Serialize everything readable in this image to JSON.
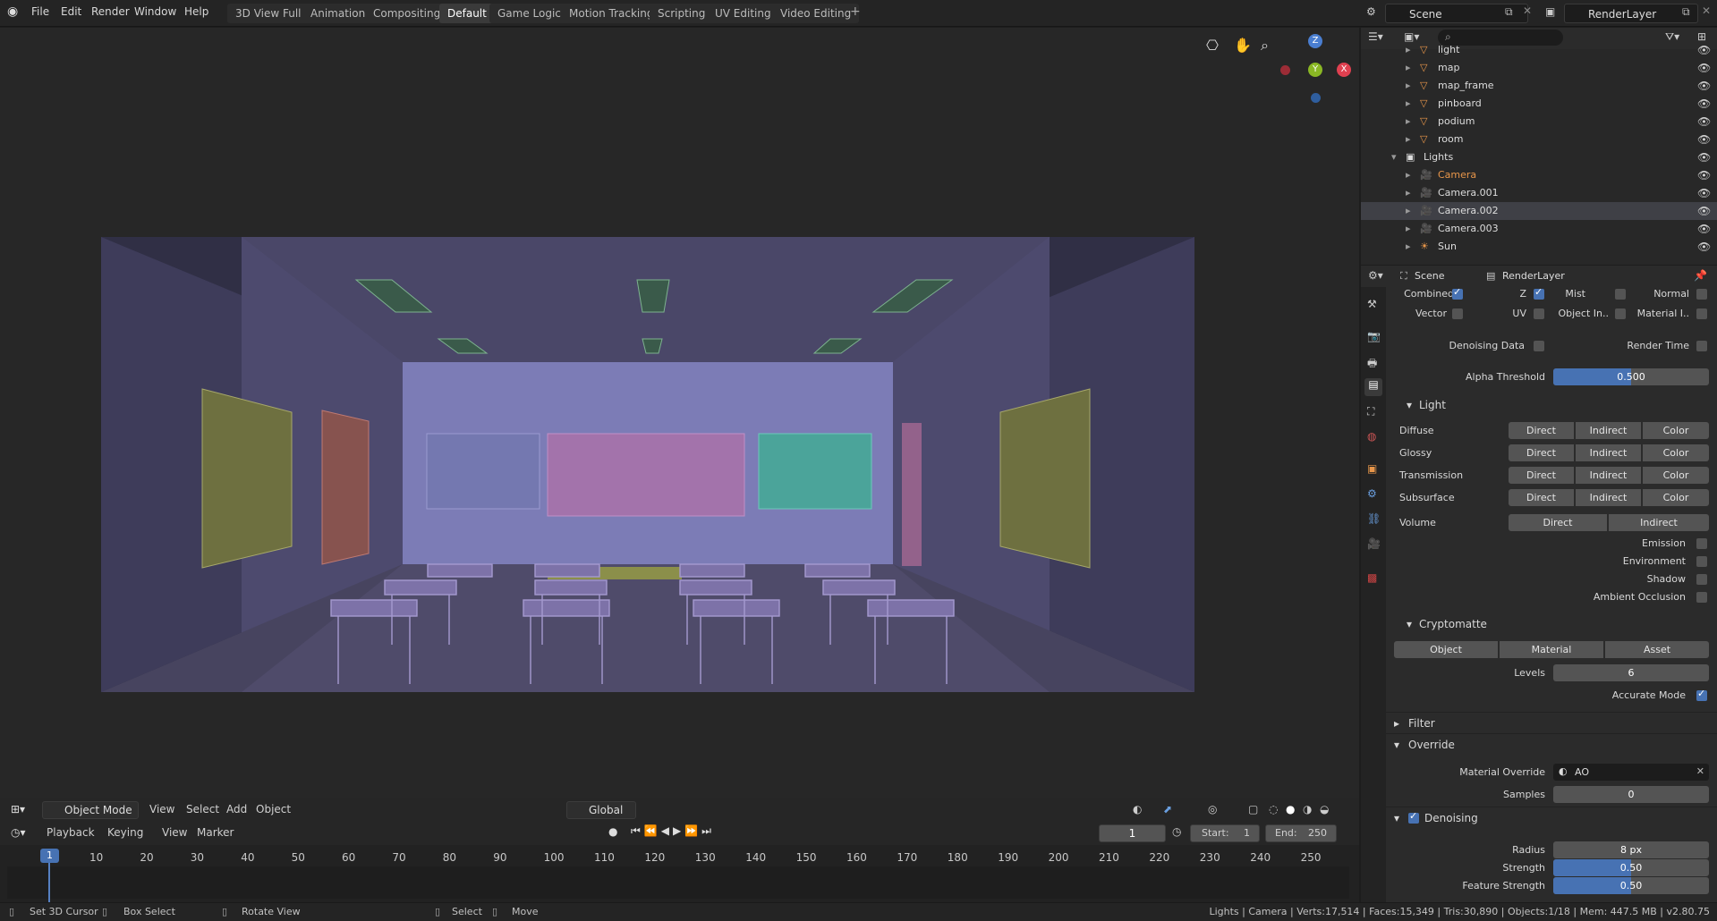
{
  "menu": {
    "file": "File",
    "edit": "Edit",
    "render": "Render",
    "window": "Window",
    "help": "Help"
  },
  "workspaces": [
    "3D View Full",
    "Animation",
    "Compositing",
    "Default",
    "Game Logic",
    "Motion Tracking",
    "Scripting",
    "UV Editing",
    "Video Editing"
  ],
  "scene_name": "Scene",
  "render_layer": "RenderLayer",
  "outliner": {
    "items": [
      {
        "name": "light",
        "sel": false
      },
      {
        "name": "map",
        "sel": false
      },
      {
        "name": "map_frame",
        "sel": false
      },
      {
        "name": "pinboard",
        "sel": false
      },
      {
        "name": "podium",
        "sel": false
      },
      {
        "name": "room",
        "sel": false
      },
      {
        "name": "Lights",
        "sel": false
      },
      {
        "name": "Camera",
        "sel": false
      },
      {
        "name": "Camera.001",
        "sel": false
      },
      {
        "name": "Camera.002",
        "sel": true
      },
      {
        "name": "Camera.003",
        "sel": false
      },
      {
        "name": "Sun",
        "sel": false
      }
    ]
  },
  "props": {
    "breadcrumb_scene": "Scene",
    "breadcrumb_layer": "RenderLayer",
    "passes": {
      "combined": "Combined",
      "z": "Z",
      "mist": "Mist",
      "normal": "Normal",
      "vector": "Vector",
      "uv": "UV",
      "object_in": "Object In..",
      "material_i": "Material I..",
      "denoising_data": "Denoising Data",
      "render_time": "Render Time"
    },
    "alpha_threshold_label": "Alpha Threshold",
    "alpha_threshold": "0.500",
    "light_section": "Light",
    "light_rows": [
      "Diffuse",
      "Glossy",
      "Transmission",
      "Subsurface"
    ],
    "volume": "Volume",
    "direct": "Direct",
    "indirect": "Indirect",
    "color": "Color",
    "emission": "Emission",
    "environment": "Environment",
    "shadow": "Shadow",
    "ambient_occlusion": "Ambient Occlusion",
    "cryptomatte": "Cryptomatte",
    "crypto_object": "Object",
    "crypto_material": "Material",
    "crypto_asset": "Asset",
    "levels_label": "Levels",
    "levels": "6",
    "accurate_mode": "Accurate Mode",
    "filter": "Filter",
    "override": "Override",
    "material_override_label": "Material Override",
    "material_override": "AO",
    "samples_label": "Samples",
    "samples": "0",
    "denoising": "Denoising",
    "radius_label": "Radius",
    "radius": "8 px",
    "strength_label": "Strength",
    "strength": "0.50",
    "feature_strength_label": "Feature Strength",
    "feature_strength": "0.50"
  },
  "vp_toolbar": {
    "mode": "Object Mode",
    "view": "View",
    "select": "Select",
    "add": "Add",
    "object": "Object",
    "orientation": "Global"
  },
  "timeline": {
    "playback": "Playback",
    "keying": "Keying",
    "view": "View",
    "marker": "Marker",
    "frame": "1",
    "start_label": "Start:",
    "start": "1",
    "end_label": "End:",
    "end": "250",
    "current": "1",
    "ticks": [
      "10",
      "20",
      "30",
      "40",
      "50",
      "60",
      "70",
      "80",
      "90",
      "100",
      "110",
      "120",
      "130",
      "140",
      "150",
      "160",
      "170",
      "180",
      "190",
      "200",
      "210",
      "220",
      "230",
      "240",
      "250"
    ]
  },
  "status": {
    "cursor": "Set 3D Cursor",
    "box": "Box Select",
    "rotate": "Rotate View",
    "select": "Select",
    "move": "Move",
    "stats": "Lights | Camera | Verts:17,514 | Faces:15,349 | Tris:30,890 | Objects:1/18 | Mem: 447.5 MB | v2.80.75"
  },
  "gizmo": {
    "z": "Z",
    "y": "Y",
    "x": "X"
  }
}
